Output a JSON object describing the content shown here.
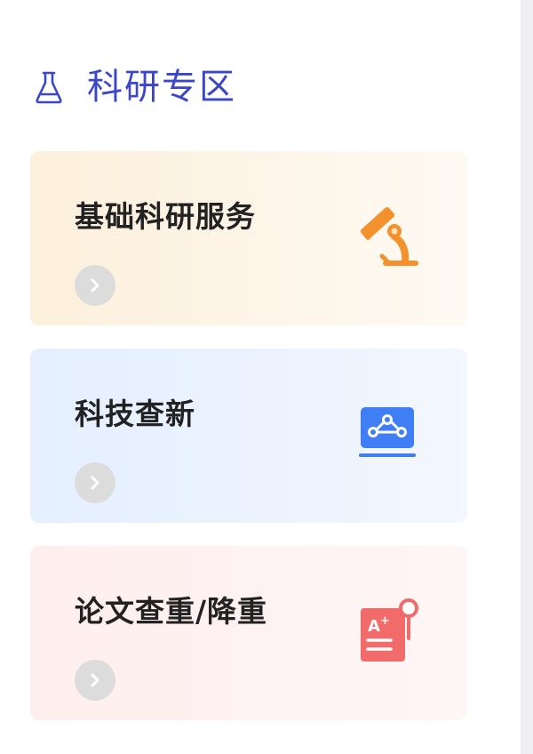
{
  "section": {
    "title": "科研专区",
    "icon": "flask-icon"
  },
  "cards": [
    {
      "title": "基础科研服务",
      "icon": "microscope-icon",
      "color": "#f3922c"
    },
    {
      "title": "科技查新",
      "icon": "network-monitor-icon",
      "color": "#3f7ef5"
    },
    {
      "title": "论文查重/降重",
      "icon": "paper-check-icon",
      "color": "#f26b6b"
    }
  ],
  "colors": {
    "accent": "#3b46c8",
    "arrow_button": "#dcdcdc"
  }
}
